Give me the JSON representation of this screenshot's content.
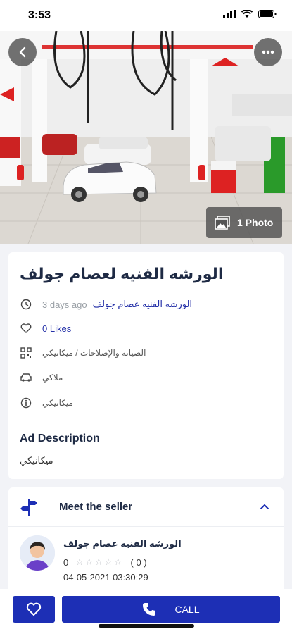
{
  "status": {
    "time": "3:53"
  },
  "hero": {
    "photo_count_label": "1 Photo"
  },
  "listing": {
    "title": "الورشه الفنيه لعصام جولف",
    "posted_ago": "3 days ago",
    "poster_link": "الورشه الفنيه عصام جولف",
    "likes": "0 Likes",
    "category": "الصيانة والإصلاحات / ميكانيكي",
    "vehicle": "ملاكي",
    "specialty": "ميكانيكي"
  },
  "description": {
    "heading": "Ad Description",
    "text": "ميكانيكي"
  },
  "seller": {
    "heading": "Meet the seller",
    "name": "الورشه الفنيه عصام جولف",
    "rating_value": "0",
    "stars": "☆☆☆☆☆",
    "rating_count": "( 0 )",
    "date": "04-05-2021 03:30:29"
  },
  "actions": {
    "call_label": "CALL"
  },
  "colors": {
    "primary": "#1d2fb5",
    "title": "#1e2a44",
    "link": "#2430a8"
  },
  "icons": [
    "back-arrow-icon",
    "more-dots-icon",
    "photos-icon",
    "clock-icon",
    "heart-icon",
    "qr-category-icon",
    "car-icon",
    "info-icon",
    "signpost-icon",
    "chevron-up-icon",
    "phone-icon"
  ]
}
